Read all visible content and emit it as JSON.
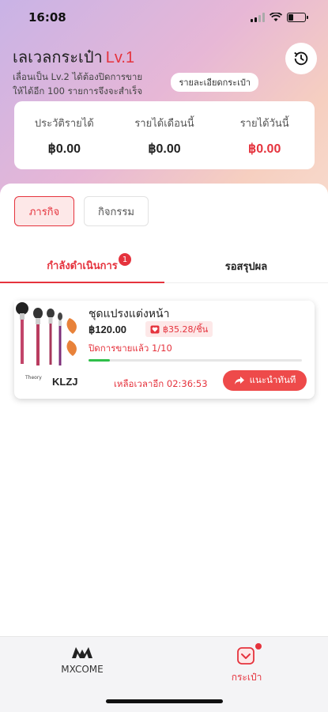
{
  "status_bar": {
    "time": "16:08"
  },
  "header": {
    "title": "เลเวลกระเป๋า",
    "level": "Lv.1",
    "desc_line1": "เลื่อนเป็น Lv.2 ได้ต้องปิดการขาย",
    "desc_line2": "ให้ได้อีก 100 รายการจึงจะสำเร็จ",
    "wallet_detail_label": "รายละเอียดกระเป๋า"
  },
  "income": [
    {
      "label": "ประวัติรายได้",
      "value": "฿0.00"
    },
    {
      "label": "รายได้เดือนนี้",
      "value": "฿0.00"
    },
    {
      "label": "รายได้วันนี้",
      "value": "฿0.00"
    }
  ],
  "filters": {
    "mission": "ภารกิจ",
    "activity": "กิจกรรม"
  },
  "subtabs": {
    "in_progress": "กำลังดำเนินการ",
    "in_progress_badge": "1",
    "pending": "รอสรุปผล"
  },
  "task": {
    "product_name": "ชุดแปรงแต่งหน้า",
    "price": "฿120.00",
    "commission": "฿35.28/ชิ้น",
    "progress_text": "ปิดการขายแล้ว 1/10",
    "progress": 0.1,
    "brand_logo": "Theory",
    "store_code": "KLZJ",
    "countdown": "เหลือเวลาอีก 02:36:53",
    "recommend_label": "แนะนำทันที"
  },
  "bottom_nav": {
    "mxcome": "MXCOME",
    "wallet": "กระเป๋า"
  },
  "colors": {
    "accent": "#e5333d",
    "progress": "#2fbf4a"
  }
}
